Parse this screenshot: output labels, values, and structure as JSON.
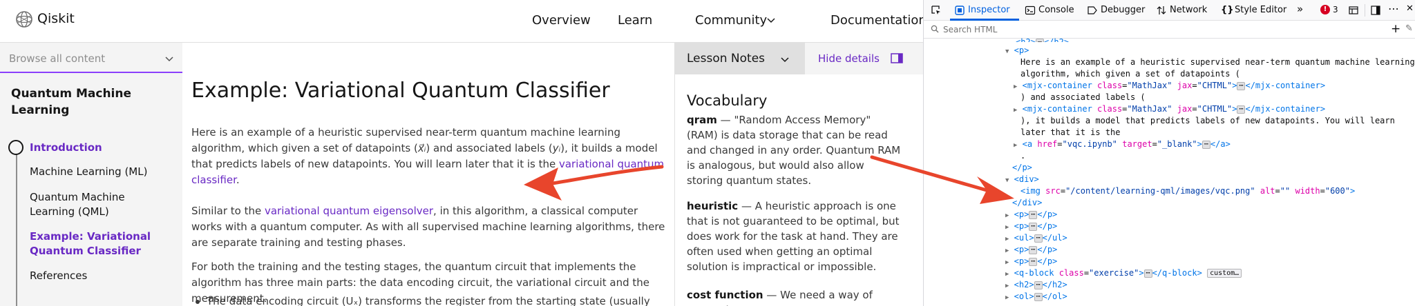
{
  "header": {
    "logo_text": "Qiskit",
    "nav": {
      "overview": "Overview",
      "learn": "Learn",
      "community": "Community",
      "documentation": "Documentation"
    }
  },
  "sidebar": {
    "browse_label": "Browse all content",
    "course_title": "Quantum Machine Learning",
    "items": [
      {
        "label": "Introduction",
        "active": true
      },
      {
        "label": "Machine Learning (ML)",
        "active": false
      },
      {
        "label": "Quantum Machine Learning (QML)",
        "active": false
      },
      {
        "label": "Example: Variational Quantum Classifier",
        "active": true
      },
      {
        "label": "References",
        "active": false
      }
    ]
  },
  "main": {
    "title": "Example: Variational Quantum Classifier",
    "p1": {
      "part1": "Here is an example of a heuristic supervised near-term quantum machine learning algorithm, which given a set of datapoints (",
      "math1": "x⃗ᵢ",
      "part2": ") and associated labels (",
      "math2": "yᵢ",
      "part3": "), it builds a model that predicts labels of new datapoints. You will learn later that it is the ",
      "link": "variational quantum classifier",
      "part4": "."
    },
    "p2": {
      "part1": "Similar to the ",
      "link": "variational quantum eigensolver",
      "part2": ", in this algorithm, a classical computer works with a quantum computer. As with all supervised machine learning algorithms, there are separate training and testing phases."
    },
    "p3": "For both the training and the testing stages, the quantum circuit that implements the algorithm has three main parts: the data encoding circuit, the variational circuit and the measurement.",
    "bullet": "The data encoding circuit (Uₓ) transforms the register from the starting state (usually"
  },
  "notes": {
    "dropdown_label": "Lesson Notes",
    "hide_details": "Hide details",
    "vocab_title": "Vocabulary",
    "entries": [
      {
        "term": "qram",
        "definition": "\"Random Access Memory\" (RAM) is data storage that can be read and changed in any order. Quantum RAM is analogous, but would also allow storing quantum states."
      },
      {
        "term": "heuristic",
        "definition": "A heuristic approach is one that is not guaranteed to be optimal, but does work for the task at hand. They are often used when getting an optimal solution is impractical or impossible."
      },
      {
        "term": "cost function",
        "definition": "We need a way of measuring"
      }
    ]
  },
  "devtools": {
    "tabs": {
      "inspector": "Inspector",
      "console": "Console",
      "debugger": "Debugger",
      "network": "Network",
      "style_editor": "Style Editor"
    },
    "error_count": "3",
    "search_placeholder": "Search HTML",
    "dom": {
      "p_text_1": "Here is an example of a heuristic supervised near-term quantum machine learning",
      "p_text_2": "algorithm, which given a set of datapoints (",
      "mjx_tag": "mjx-container",
      "mjx_class": "MathJax",
      "mjx_jax": "CHTML",
      "text_labels": ") and associated labels (",
      "text_builds_1": "), it builds a model that predicts labels of new datapoints. You will learn",
      "text_builds_2": "later that it is the",
      "a_href": "vqc.ipynb",
      "a_target": "_blank",
      "period": ".",
      "img_src": "/content/learning-qml/images/vqc.png",
      "img_alt": "",
      "img_width": "600",
      "qblock_class": "exercise",
      "custom_badge": "custom…"
    }
  },
  "colors": {
    "accent": "#6929c4",
    "arrow": "#e8452c",
    "devtools_blue": "#0060df"
  }
}
